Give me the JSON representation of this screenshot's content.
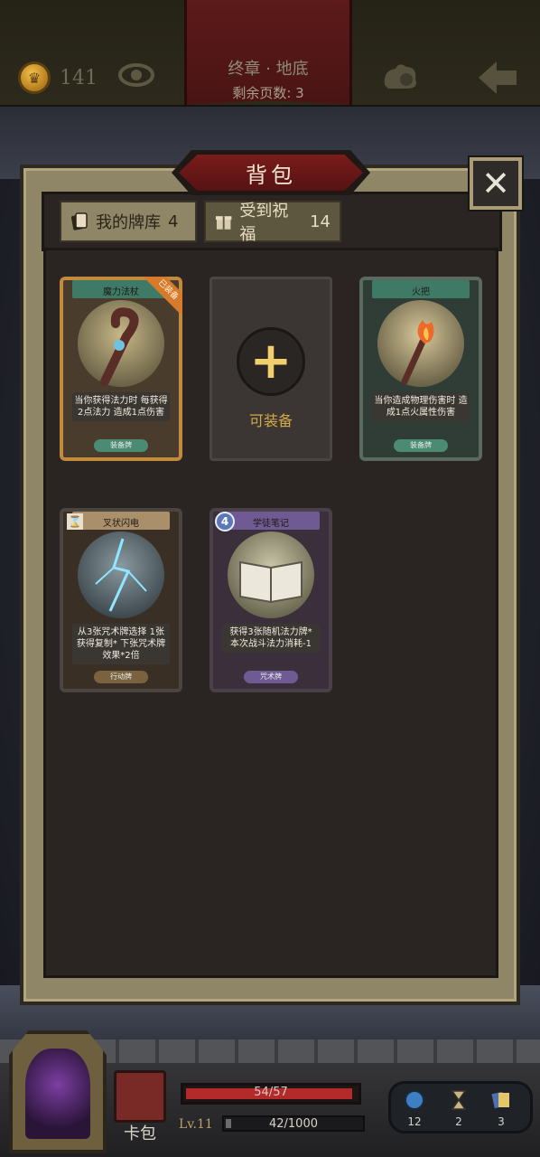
{
  "header": {
    "coins": "141",
    "chapter_title": "终章 · 地底",
    "pages_left": "剩余页数: 3"
  },
  "backpack": {
    "title": "背包",
    "tabs": [
      {
        "label": "我的牌库",
        "count": "4"
      },
      {
        "label": "受到祝福",
        "count": "14"
      }
    ],
    "equippable_label": "可装备",
    "cards": [
      {
        "name": "魔力法杖",
        "equipped_flag": "已装备",
        "desc": "当你获得法力时 每获得2点法力 造成1点伤害",
        "tag": "装备牌"
      },
      {
        "name": "火把",
        "desc": "当你造成物理伤害时 造成1点火属性伤害",
        "tag": "装备牌"
      },
      {
        "name": "叉状闪电",
        "desc": "从3张咒术牌选择 1张获得复制* 下张咒术牌效果*2倍",
        "tag": "行动牌"
      },
      {
        "name": "学徒笔记",
        "cost": "4",
        "desc": "获得3张随机法力牌* 本次战斗法力消耗-1",
        "tag": "咒术牌"
      }
    ]
  },
  "footer": {
    "card_pack_label": "卡包",
    "hp_text": "54/57",
    "hp_fraction": 0.947,
    "level": "Lv.11",
    "xp_text": "42/1000",
    "xp_fraction": 0.042,
    "resources": [
      {
        "name": "mana-orb",
        "count": "12"
      },
      {
        "name": "hourglass",
        "count": "2"
      },
      {
        "name": "cards",
        "count": "3"
      }
    ]
  },
  "colors": {
    "panel": "#8f8567",
    "banner": "#7a1c1c",
    "gold": "#d3aa48",
    "hp": "#b22a2a"
  }
}
